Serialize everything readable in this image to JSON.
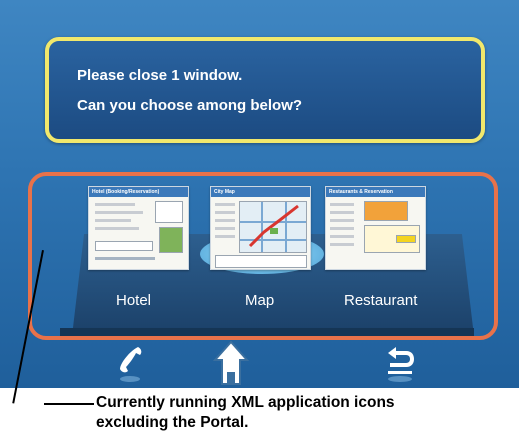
{
  "dialog": {
    "line1": "Please close 1 window.",
    "line2": "Can you choose among below?"
  },
  "apps": [
    {
      "label": "Hotel",
      "thumb_title": "Hotel (Booking/Reservation)",
      "icon": "hotel-app-thumbnail"
    },
    {
      "label": "Map",
      "thumb_title": "City Map",
      "icon": "map-app-thumbnail"
    },
    {
      "label": "Restaurant",
      "thumb_title": "Restaurants & Reservation",
      "icon": "restaurant-app-thumbnail"
    }
  ],
  "bottom_bar": {
    "icons": [
      "phone-icon",
      "home-icon",
      "back-icon"
    ]
  },
  "caption": {
    "line1": "Currently running XML application icons",
    "line2": "excluding the Portal."
  },
  "colors": {
    "background": "#2e74b2",
    "dialog_border": "#f1e86c",
    "selector_border": "#e8724a",
    "highlight": "#8fd0f0"
  }
}
